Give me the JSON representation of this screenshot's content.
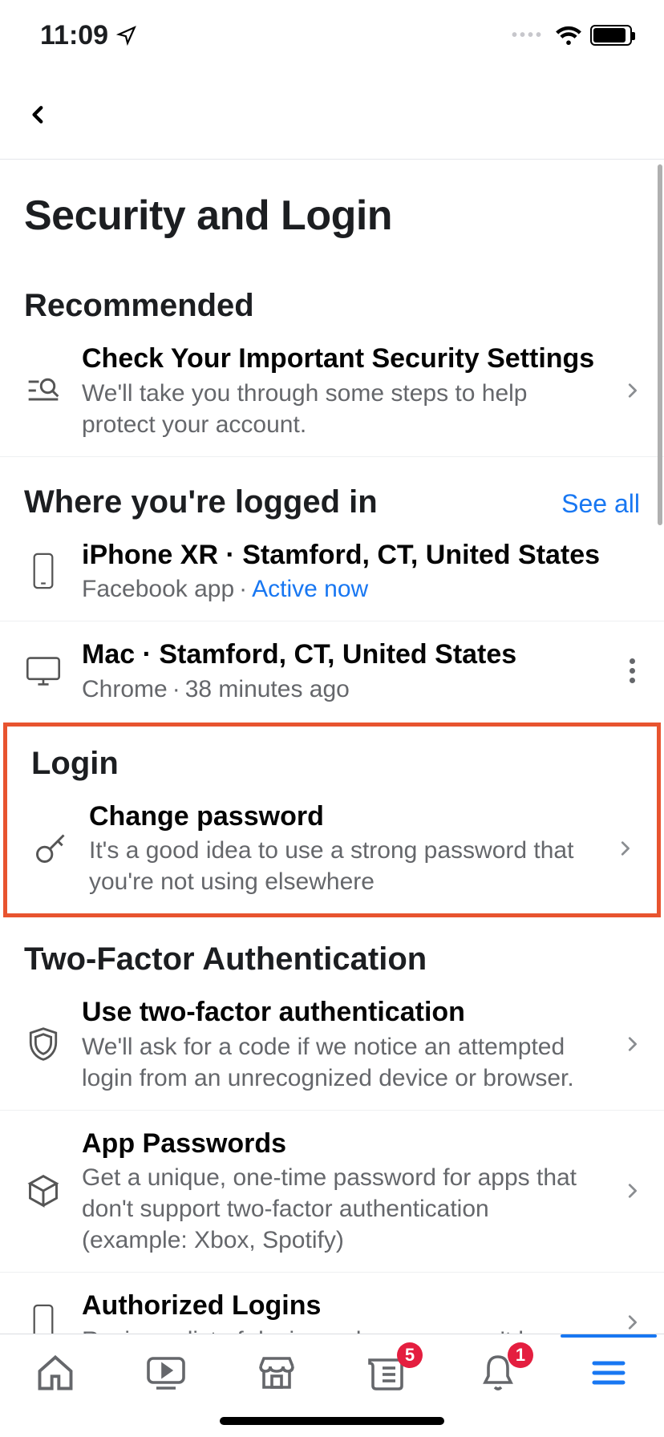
{
  "status": {
    "time": "11:09"
  },
  "page": {
    "title": "Security and Login"
  },
  "sections": {
    "recommended": {
      "heading": "Recommended",
      "item": {
        "title": "Check Your Important Security Settings",
        "subtitle": "We'll take you through some steps to help protect your account."
      }
    },
    "logged_in": {
      "heading": "Where you're logged in",
      "see_all": "See all",
      "sessions": [
        {
          "title": "iPhone XR · Stamford, CT, United States",
          "app": "Facebook app",
          "status": "Active now"
        },
        {
          "title": "Mac · Stamford, CT, United States",
          "app": "Chrome",
          "status": "38 minutes ago"
        }
      ]
    },
    "login": {
      "heading": "Login",
      "item": {
        "title": "Change password",
        "subtitle": "It's a good idea to use a strong password that you're not using elsewhere"
      }
    },
    "twofa": {
      "heading": "Two-Factor Authentication",
      "items": [
        {
          "title": "Use two-factor authentication",
          "subtitle": "We'll ask for a code if we notice an attempted login from an unrecognized device or browser."
        },
        {
          "title": "App Passwords",
          "subtitle": "Get a unique, one-time password for apps that don't support two-factor authentication (example: Xbox, Spotify)"
        },
        {
          "title": "Authorized Logins",
          "subtitle": "Review a list of devices where you won't have"
        }
      ]
    }
  },
  "tabbar": {
    "news_badge": "5",
    "notif_badge": "1"
  }
}
